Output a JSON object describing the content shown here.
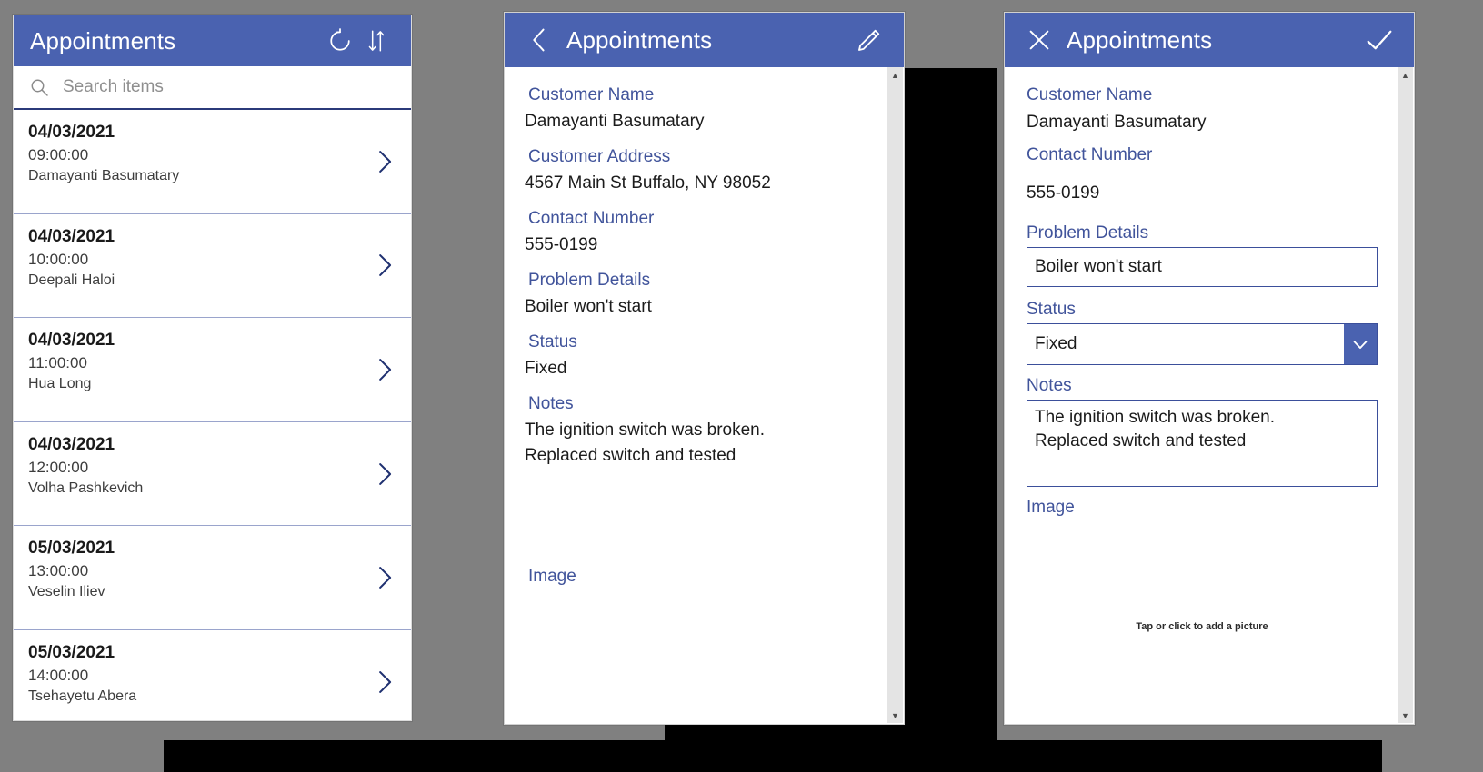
{
  "app": {
    "title": "Appointments",
    "brand_color": "#4a62b0",
    "label_color": "#41549b",
    "border_color": "#3b4f9b"
  },
  "browse_screen": {
    "title": "Appointments",
    "refresh_icon": "refresh-icon",
    "sort_icon": "sort-icon",
    "search": {
      "icon": "search-icon",
      "value": "",
      "placeholder": "Search items"
    },
    "items": [
      {
        "date": "04/03/2021",
        "time": "09:00:00",
        "name": "Damayanti Basumatary",
        "chevron": "chevron-right-icon"
      },
      {
        "date": "04/03/2021",
        "time": "10:00:00",
        "name": "Deepali Haloi",
        "chevron": "chevron-right-icon"
      },
      {
        "date": "04/03/2021",
        "time": "11:00:00",
        "name": "Hua Long",
        "chevron": "chevron-right-icon"
      },
      {
        "date": "04/03/2021",
        "time": "12:00:00",
        "name": "Volha Pashkevich",
        "chevron": "chevron-right-icon"
      },
      {
        "date": "05/03/2021",
        "time": "13:00:00",
        "name": "Veselin Iliev",
        "chevron": "chevron-right-icon"
      },
      {
        "date": "05/03/2021",
        "time": "14:00:00",
        "name": "Tsehayetu Abera",
        "chevron": "chevron-right-icon"
      }
    ]
  },
  "detail_screen": {
    "title": "Appointments",
    "back_icon": "chevron-left-icon",
    "edit_icon": "pencil-icon",
    "fields": [
      {
        "label": "Customer Name",
        "value": "Damayanti Basumatary"
      },
      {
        "label": "Customer Address",
        "value": "4567 Main St Buffalo, NY 98052"
      },
      {
        "label": "Contact Number",
        "value": "555-0199"
      },
      {
        "label": "Problem Details",
        "value": "Boiler won't start"
      },
      {
        "label": "Status",
        "value": "Fixed"
      },
      {
        "label": "Notes",
        "value": "The ignition switch was broken.\nReplaced switch and tested"
      }
    ],
    "image_label": "Image"
  },
  "edit_screen": {
    "title": "Appointments",
    "cancel_icon": "close-icon",
    "save_icon": "checkmark-icon",
    "customer_name_label": "Customer Name",
    "customer_name_value": "Damayanti Basumatary",
    "contact_number_label": "Contact Number",
    "contact_number_value": "555-0199",
    "problem_details_label": "Problem Details",
    "problem_details_value": "Boiler won't start",
    "status_label": "Status",
    "status_value": "Fixed",
    "status_arrow_icon": "chevron-down-icon",
    "notes_label": "Notes",
    "notes_value": "The ignition switch was broken.\nReplaced switch and tested",
    "image_label": "Image",
    "image_placeholder": "Tap or click to add a picture"
  }
}
